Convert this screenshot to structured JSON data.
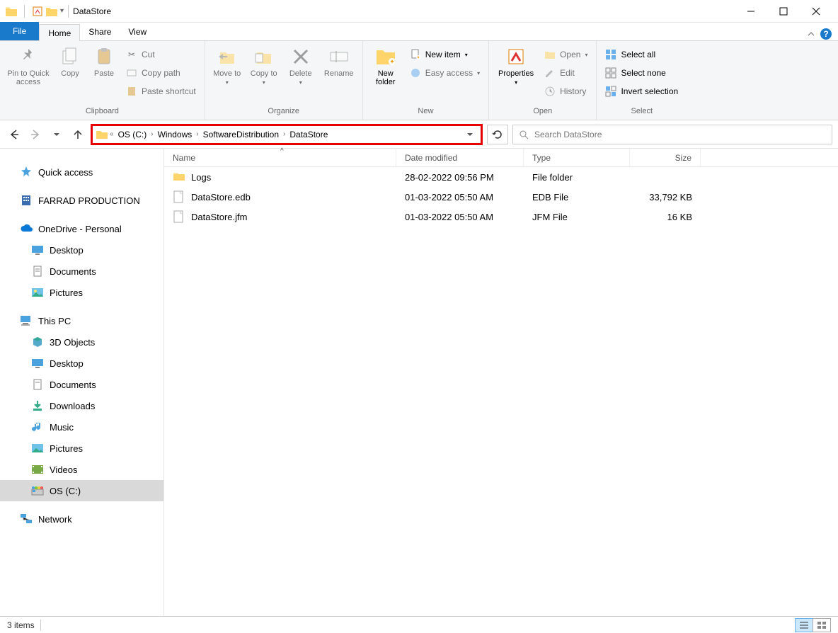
{
  "window": {
    "title": "DataStore"
  },
  "tabs": {
    "file": "File",
    "home": "Home",
    "share": "Share",
    "view": "View"
  },
  "ribbon": {
    "clipboard": {
      "label": "Clipboard",
      "pinQuick": "Pin to Quick access",
      "copy": "Copy",
      "paste": "Paste",
      "cut": "Cut",
      "copyPath": "Copy path",
      "pasteShortcut": "Paste shortcut"
    },
    "organize": {
      "label": "Organize",
      "moveTo": "Move to",
      "copyTo": "Copy to",
      "delete": "Delete",
      "rename": "Rename"
    },
    "new": {
      "label": "New",
      "newFolder": "New folder",
      "newItem": "New item",
      "easyAccess": "Easy access"
    },
    "open": {
      "label": "Open",
      "properties": "Properties",
      "open": "Open",
      "edit": "Edit",
      "history": "History"
    },
    "select": {
      "label": "Select",
      "selectAll": "Select all",
      "selectNone": "Select none",
      "invert": "Invert selection"
    }
  },
  "breadcrumb": {
    "items": [
      "OS (C:)",
      "Windows",
      "SoftwareDistribution",
      "DataStore"
    ]
  },
  "search": {
    "placeholder": "Search DataStore"
  },
  "nav": {
    "quickAccess": "Quick access",
    "farrad": "FARRAD PRODUCTION",
    "onedrive": "OneDrive - Personal",
    "odItems": [
      "Desktop",
      "Documents",
      "Pictures"
    ],
    "thisPC": "This PC",
    "pcItems": [
      "3D Objects",
      "Desktop",
      "Documents",
      "Downloads",
      "Music",
      "Pictures",
      "Videos",
      "OS (C:)"
    ],
    "network": "Network"
  },
  "columns": {
    "name": "Name",
    "date": "Date modified",
    "type": "Type",
    "size": "Size"
  },
  "files": [
    {
      "name": "Logs",
      "date": "28-02-2022 09:56 PM",
      "type": "File folder",
      "size": "",
      "kind": "folder"
    },
    {
      "name": "DataStore.edb",
      "date": "01-03-2022 05:50 AM",
      "type": "EDB File",
      "size": "33,792 KB",
      "kind": "file"
    },
    {
      "name": "DataStore.jfm",
      "date": "01-03-2022 05:50 AM",
      "type": "JFM File",
      "size": "16 KB",
      "kind": "file"
    }
  ],
  "status": {
    "items": "3 items"
  }
}
